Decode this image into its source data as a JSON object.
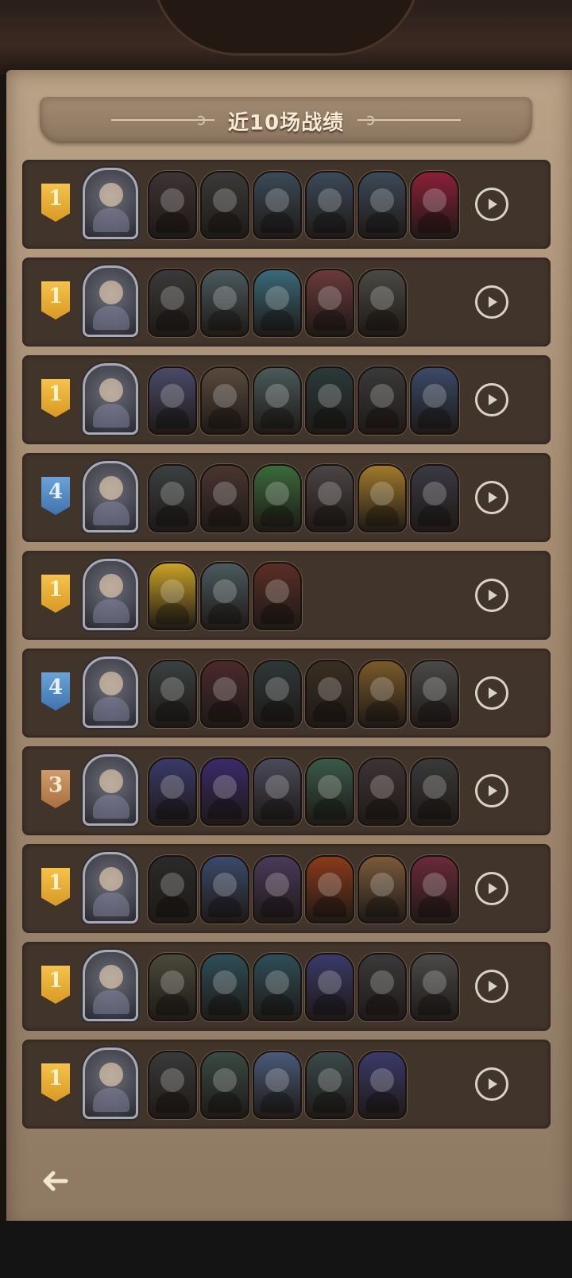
{
  "title": "近10场战绩",
  "matches": [
    {
      "rank": "1",
      "rank_color": "gold",
      "units": [
        "#3d3435",
        "#3a3a3a",
        "#3b4a58",
        "#3b4a58",
        "#3b4a58",
        "#8a2038"
      ]
    },
    {
      "rank": "1",
      "rank_color": "gold",
      "units": [
        "#3a3a3a",
        "#4b5a5e",
        "#3a6a7a",
        "#6a3a3a",
        "#4a4a44"
      ]
    },
    {
      "rank": "1",
      "rank_color": "gold",
      "units": [
        "#4a4a6a",
        "#5a4a3e",
        "#4a5a5a",
        "#2a3a3a",
        "#3a3a3a",
        "#3a4a6a"
      ]
    },
    {
      "rank": "4",
      "rank_color": "blue",
      "units": [
        "#3a4040",
        "#4a3530",
        "#3a6a3a",
        "#4a4444",
        "#a07a2a",
        "#3a3a44"
      ]
    },
    {
      "rank": "1",
      "rank_color": "gold",
      "units": [
        "#c9a226",
        "#4b5a5e",
        "#5a2e26"
      ]
    },
    {
      "rank": "4",
      "rank_color": "blue",
      "units": [
        "#3a4040",
        "#4a2a2a",
        "#2e3838",
        "#3a2e22",
        "#7a5a2a",
        "#4a4a4a"
      ]
    },
    {
      "rank": "3",
      "rank_color": "bronze",
      "units": [
        "#3a3a6a",
        "#3a2a6a",
        "#4a4a5a",
        "#3a5a48",
        "#3d3435",
        "#3a3a3a"
      ]
    },
    {
      "rank": "1",
      "rank_color": "gold",
      "units": [
        "#2a2a2a",
        "#3a4a6a",
        "#4a3a5a",
        "#8a3a1a",
        "#7a5a3a",
        "#6a2a3a"
      ]
    },
    {
      "rank": "1",
      "rank_color": "gold",
      "units": [
        "#4a4a3a",
        "#2e4e58",
        "#2e4e58",
        "#3a3a6a",
        "#3a3a3a",
        "#4a4a4a"
      ]
    },
    {
      "rank": "1",
      "rank_color": "gold",
      "units": [
        "#3a3a3a",
        "#3a4a44",
        "#4a5a7a",
        "#3a4a4a",
        "#3a3a6a"
      ]
    }
  ]
}
